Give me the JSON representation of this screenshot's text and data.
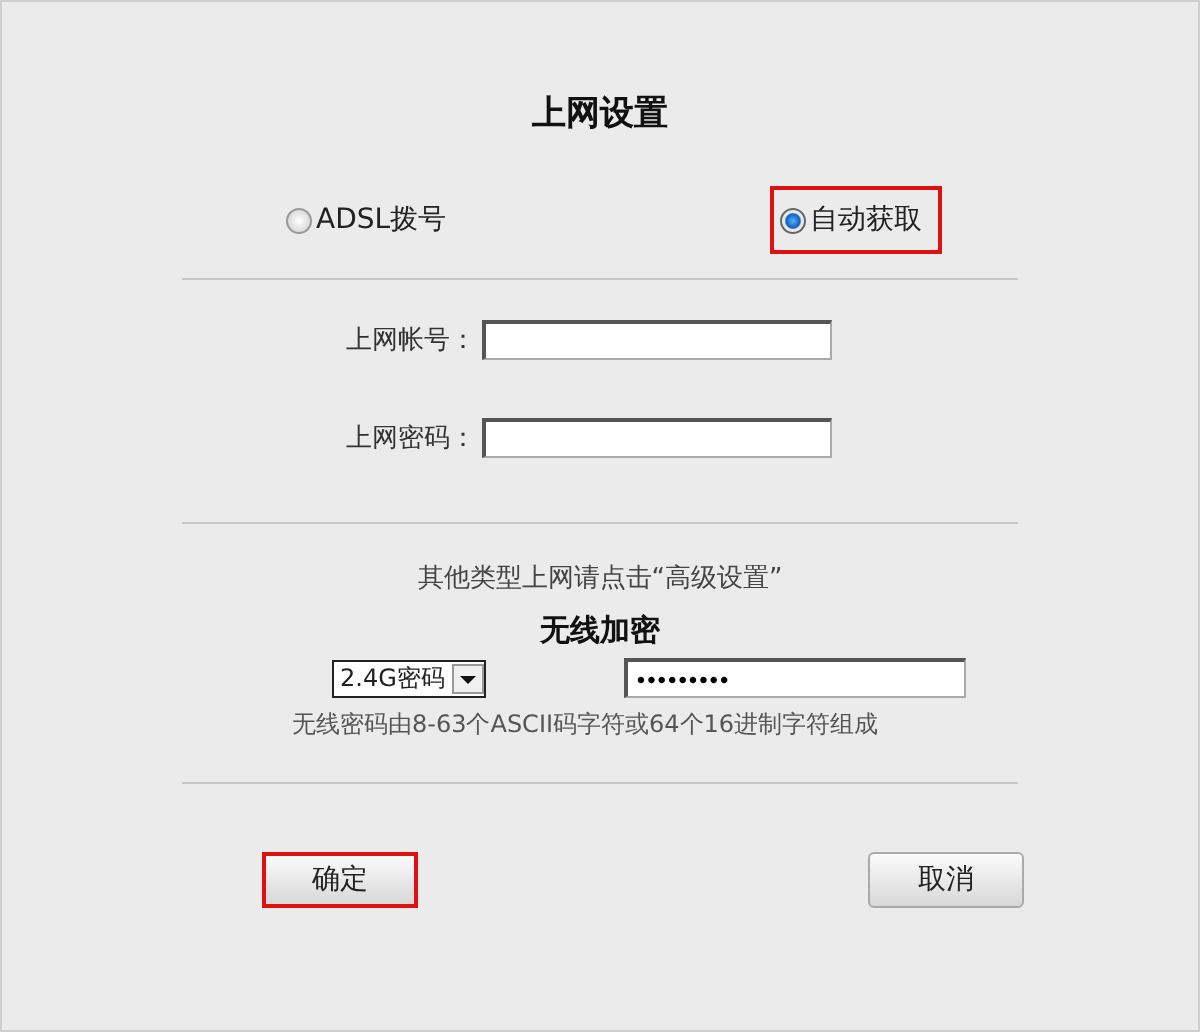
{
  "title": "上网设置",
  "modes": [
    {
      "label": "ADSL拨号",
      "selected": false,
      "highlighted": false
    },
    {
      "label": "自动获取",
      "selected": true,
      "highlighted": true
    }
  ],
  "fields": [
    {
      "label": "上网帐号："
    },
    {
      "label": "上网密码："
    }
  ],
  "hint": "其他类型上网请点击“高级设置”",
  "wireless": {
    "heading": "无线加密",
    "band": "2.4G密码",
    "password": "•••••••••",
    "note": "无线密码由8-63个ASCII码字符或64个16进制字符组成"
  },
  "buttons": [
    {
      "label": "确定",
      "highlighted": true
    },
    {
      "label": "取消",
      "highlighted": false
    }
  ]
}
